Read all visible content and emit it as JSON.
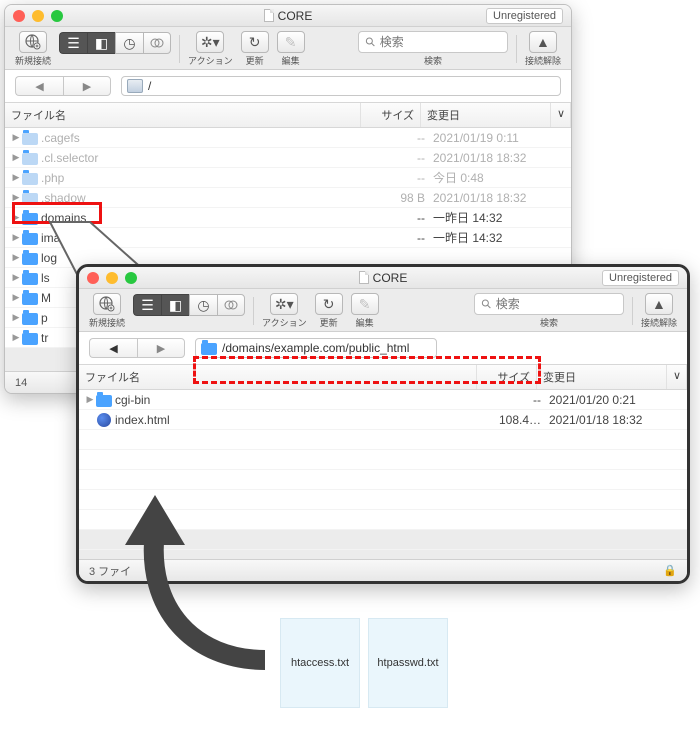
{
  "win1": {
    "title": "CORE",
    "unregistered": "Unregistered",
    "toolbar": {
      "new_connection": "新規接続",
      "action": "アクション",
      "refresh": "更新",
      "edit": "編集",
      "search_placeholder": "検索",
      "search_label": "検索",
      "disconnect": "接続解除"
    },
    "path": "/",
    "columns": {
      "name": "ファイル名",
      "size": "サイズ",
      "date": "変更日",
      "sort": "∨"
    },
    "rows": [
      {
        "name": ".cagefs",
        "size": "--",
        "date": "2021/01/19 0:11",
        "dim": true
      },
      {
        "name": ".cl.selector",
        "size": "--",
        "date": "2021/01/18 18:32",
        "dim": true
      },
      {
        "name": ".php",
        "size": "--",
        "date": "今日 0:48",
        "dim": true
      },
      {
        "name": ".shadow",
        "size": "98 B",
        "date": "2021/01/18 18:32",
        "dim": true
      },
      {
        "name": "domains",
        "size": "--",
        "date": "一昨日 14:32",
        "dim": false
      },
      {
        "name": "imap",
        "size": "--",
        "date": "一昨日 14:32",
        "dim": false
      },
      {
        "name": "log",
        "size": "",
        "date": "",
        "dim": false
      },
      {
        "name": "ls",
        "size": "",
        "date": "",
        "dim": false
      },
      {
        "name": "M",
        "size": "",
        "date": "",
        "dim": false
      },
      {
        "name": "p",
        "size": "",
        "date": "",
        "dim": false
      },
      {
        "name": "tr",
        "size": "",
        "date": "",
        "dim": false
      }
    ],
    "status": "14"
  },
  "win2": {
    "title": "CORE",
    "unregistered": "Unregistered",
    "toolbar": {
      "new_connection": "新規接続",
      "action": "アクション",
      "refresh": "更新",
      "edit": "編集",
      "search_placeholder": "検索",
      "search_label": "検索",
      "disconnect": "接続解除"
    },
    "path": "/domains/example.com/public_html",
    "columns": {
      "name": "ファイル名",
      "size": "サイズ",
      "date": "変更日",
      "sort": "∨"
    },
    "rows": [
      {
        "name": "cgi-bin",
        "type": "folder",
        "size": "--",
        "date": "2021/01/20 0:21"
      },
      {
        "name": "index.html",
        "type": "file",
        "size": "108.4…",
        "date": "2021/01/18 18:32"
      }
    ],
    "status": "3 ファイ"
  },
  "files": {
    "a": "htaccess.txt",
    "b": "htpasswd.txt"
  },
  "caption": {
    "l1": "",
    "l2": "",
    "l3": ""
  }
}
